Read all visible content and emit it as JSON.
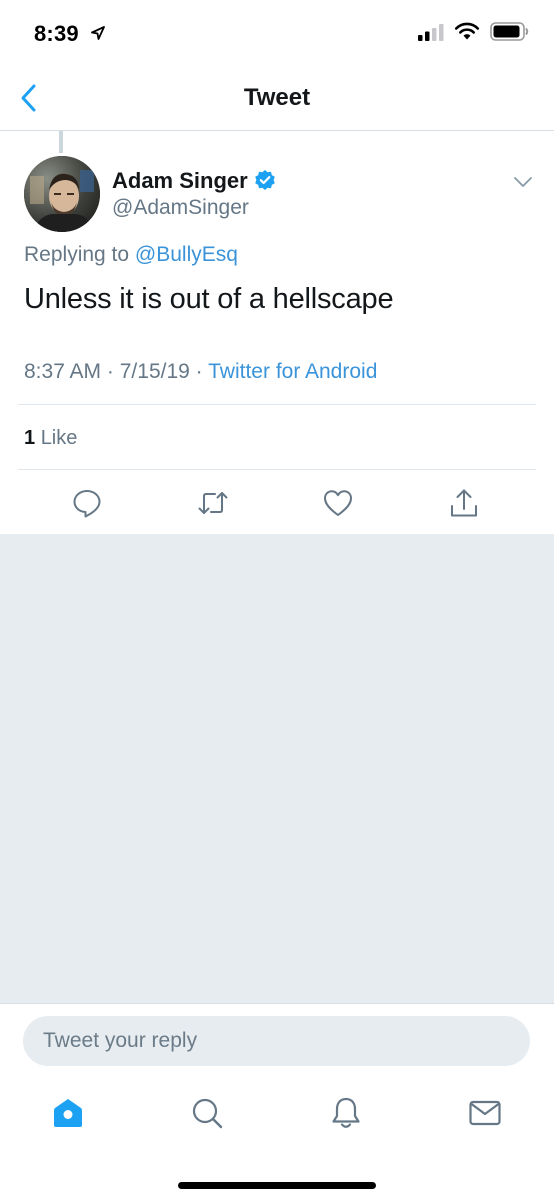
{
  "status_bar": {
    "time": "8:39"
  },
  "nav": {
    "title": "Tweet",
    "back_icon": "chevron-left-icon"
  },
  "tweet": {
    "author": {
      "display_name": "Adam Singer",
      "handle": "@AdamSinger",
      "verified": true
    },
    "replying_prefix": "Replying to",
    "replying_to": "@BullyEsq",
    "text": "Unless it is out of a hellscape",
    "time": "8:37 AM",
    "date": "7/15/19",
    "separator": "·",
    "source": "Twitter for Android",
    "likes_count": "1",
    "likes_label": "Like",
    "actions": [
      "reply-icon",
      "retweet-icon",
      "like-icon",
      "share-icon"
    ]
  },
  "reply_bar": {
    "placeholder": "Tweet your reply"
  },
  "tab_bar": {
    "tabs": [
      "home-icon",
      "search-icon",
      "notifications-icon",
      "messages-icon"
    ]
  },
  "colors": {
    "accent": "#1da1f2",
    "link": "#3b94d9",
    "secondary_text": "#657786",
    "background": "#e6ecf0",
    "verified": "#1da1f2"
  }
}
